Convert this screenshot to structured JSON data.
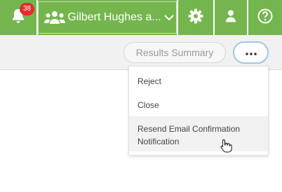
{
  "topbar": {
    "notifications": {
      "icon": "bell-icon",
      "count": "38"
    },
    "team_selector": {
      "label": "Gilbert Hughes a...",
      "icon": "users-icon",
      "chevron": "chevron-down-icon"
    },
    "settings": {
      "icon": "gear-icon"
    },
    "profile": {
      "icon": "user-icon"
    },
    "help": {
      "icon": "help-icon"
    }
  },
  "toolbar": {
    "results_summary_label": "Results Summary",
    "more_button": {
      "icon": "ellipsis-icon"
    }
  },
  "menu": {
    "items": [
      {
        "label": "Reject"
      },
      {
        "label": "Close"
      },
      {
        "label": "Resend Email Confirmation Notification"
      }
    ]
  },
  "colors": {
    "topbar": "#74b64d",
    "badge": "#e52b2b",
    "hover_row": "#f2f2f2"
  }
}
